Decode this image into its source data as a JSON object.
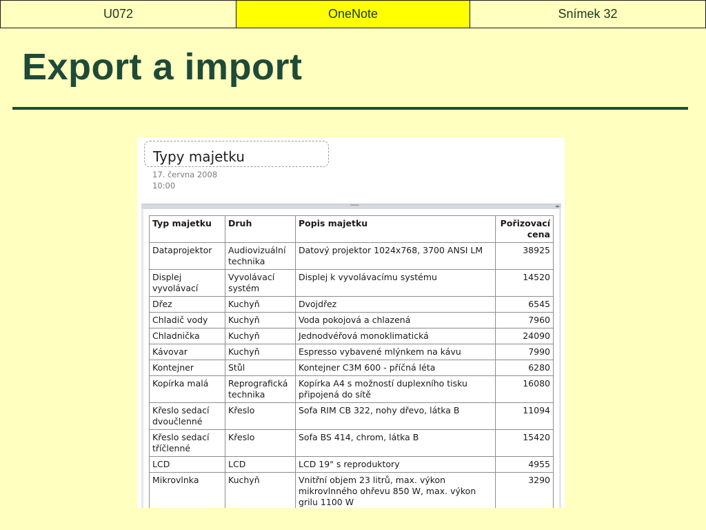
{
  "header": {
    "left": "U072",
    "center": "OneNote",
    "right": "Snímek 32"
  },
  "slide_title": "Export a import",
  "onenote": {
    "page_title": "Typy majetku",
    "date": "17. června 2008",
    "time": "10:00",
    "table": {
      "headers": [
        "Typ majetku",
        "Druh",
        "Popis majetku",
        "Pořizovací cena"
      ],
      "rows": [
        [
          "Dataprojektor",
          "Audiovizuální technika",
          "Datový projektor 1024x768, 3700 ANSI LM",
          "38925"
        ],
        [
          "Displej vyvolávací",
          "Vyvolávací systém",
          "Displej k vyvolávacímu systému",
          "14520"
        ],
        [
          "Dřez",
          "Kuchyň",
          "Dvojdřez",
          "6545"
        ],
        [
          "Chladič vody",
          "Kuchyň",
          "Voda pokojová a chlazená",
          "7960"
        ],
        [
          "Chladnička",
          "Kuchyň",
          "Jednodvéřová monoklimatická",
          "24090"
        ],
        [
          "Kávovar",
          "Kuchyň",
          "Espresso vybavené mlýnkem na kávu",
          "7990"
        ],
        [
          "Kontejner",
          "Stůl",
          "Kontejner C3M 600 - příčná léta",
          "6280"
        ],
        [
          "Kopírka malá",
          "Reprografická technika",
          "Kopírka A4 s možností duplexního tisku připojená do sítě",
          "16080"
        ],
        [
          "Křeslo sedací dvoučlenné",
          "Křeslo",
          "Sofa RIM CB 322, nohy dřevo, látka B",
          "11094"
        ],
        [
          "Křeslo sedací tříčlenné",
          "Křeslo",
          "Sofa BS 414, chrom, látka B",
          "15420"
        ],
        [
          "LCD",
          "LCD",
          "LCD 19\" s reproduktory",
          "4955"
        ],
        [
          "Mikrovlnka",
          "Kuchyň",
          "Vnitřní objem 23 litrů, max. výkon mikrovlnného ohřevu 850 W, max. výkon grilu 1100 W",
          "3290"
        ]
      ]
    }
  }
}
